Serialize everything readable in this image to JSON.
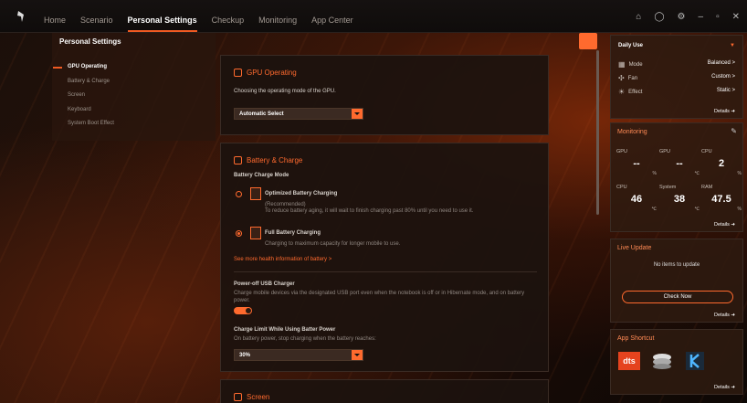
{
  "nav": {
    "items": [
      "Home",
      "Scenario",
      "Personal Settings",
      "Checkup",
      "Monitoring",
      "App Center"
    ],
    "active_index": 2
  },
  "left": {
    "title": "Personal Settings",
    "items": [
      "GPU Operating",
      "Battery & Charge",
      "Screen",
      "Keyboard",
      "System Boot Effect"
    ]
  },
  "gpu": {
    "title": "GPU Operating",
    "desc": "Choosing the operating mode of the GPU.",
    "select_value": "Automatic Select"
  },
  "battery": {
    "title": "Battery & Charge",
    "mode_label": "Battery Charge Mode",
    "opt1_title": "Optimized Battery Charging",
    "opt1_rec": "(Recommended)",
    "opt1_desc": "To reduce battery aging, it will wait to finish charging past 80% until you need to use it.",
    "opt2_title": "Full Battery Charging",
    "opt2_desc": "Charging to maximum capacity for longer mobile to use.",
    "health_link": "See more health information of battery >",
    "usb_title": "Power-off USB Charger",
    "usb_desc": "Charge mobile devices via the designated USB port even when the notebook is off or in Hibernate mode, and on battery power.",
    "limit_title": "Charge Limit While Using Batter Power",
    "limit_desc": "On battery power, stop charging when the battery reaches:",
    "limit_value": "30%"
  },
  "screen": {
    "title": "Screen"
  },
  "right": {
    "profile": "Daily Use",
    "mode_label": "Mode",
    "mode_value": "Balanced >",
    "fan_label": "Fan",
    "fan_value": "Custom >",
    "effect_label": "Effect",
    "effect_value": "Static >",
    "details": "Details",
    "monitoring_title": "Monitoring",
    "stats": [
      {
        "label": "GPU",
        "value": "--",
        "unit": "%"
      },
      {
        "label": "GPU",
        "value": "--",
        "unit": "℃"
      },
      {
        "label": "CPU",
        "value": "2",
        "unit": "%"
      },
      {
        "label": "CPU",
        "value": "46",
        "unit": "℃"
      },
      {
        "label": "System",
        "value": "38",
        "unit": "℃"
      },
      {
        "label": "RAM",
        "value": "47.5",
        "unit": "%"
      }
    ],
    "live_title": "Live Update",
    "live_text": "No items to update",
    "check_now": "Check Now",
    "shortcut_title": "App Shortcut",
    "dts": "dts"
  },
  "colors": {
    "accent": "#ff6a2e"
  }
}
